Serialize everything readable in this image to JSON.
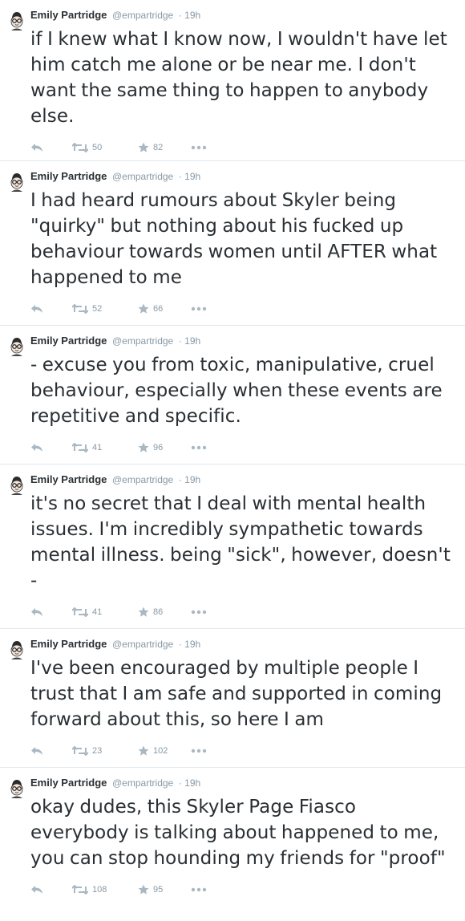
{
  "colors": {
    "text": "#292f33",
    "meta": "#8899a6",
    "icon": "#aab8c2",
    "divider": "#e1e8ed"
  },
  "tweets": [
    {
      "name": "Emily Partridge",
      "handle": "@empartridge",
      "time": "· 19h",
      "text": "if I knew what I know now, I wouldn't have let him catch me alone or be near me. I don't want the same thing to happen to anybody else.",
      "retweets": "50",
      "favorites": "82"
    },
    {
      "name": "Emily Partridge",
      "handle": "@empartridge",
      "time": "· 19h",
      "text": "I had heard rumours about Skyler being \"quirky\" but nothing about his fucked up behaviour towards women until AFTER what happened to me",
      "retweets": "52",
      "favorites": "66"
    },
    {
      "name": "Emily Partridge",
      "handle": "@empartridge",
      "time": "· 19h",
      "text": "- excuse you from toxic, manipulative, cruel behaviour, especially when these events are repetitive and specific.",
      "retweets": "41",
      "favorites": "96"
    },
    {
      "name": "Emily Partridge",
      "handle": "@empartridge",
      "time": "· 19h",
      "text": "it's no secret that I deal with mental health issues. I'm incredibly sympathetic towards mental illness. being \"sick\", however, doesn't -",
      "retweets": "41",
      "favorites": "86"
    },
    {
      "name": "Emily Partridge",
      "handle": "@empartridge",
      "time": "· 19h",
      "text": "I've been encouraged by multiple people I trust that I am safe and supported in coming forward about this, so here I am",
      "retweets": "23",
      "favorites": "102"
    },
    {
      "name": "Emily Partridge",
      "handle": "@empartridge",
      "time": "· 19h",
      "text": "okay dudes, this Skyler Page Fiasco everybody is talking about happened to me, you can stop hounding my friends for \"proof\"",
      "retweets": "108",
      "favorites": "95"
    }
  ]
}
